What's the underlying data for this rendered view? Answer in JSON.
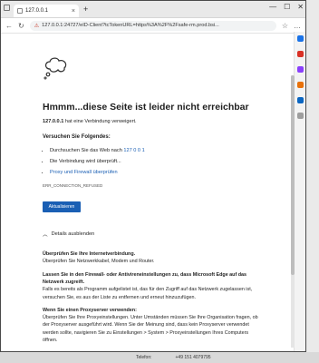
{
  "browser": {
    "tab_title": "127.0.0.1",
    "tab_close": "×",
    "new_tab": "+",
    "minimize": "—",
    "maximize": "☐",
    "close": "✕",
    "url_warning": "⚠",
    "url": "127.0.0.1:24727/eID-Client?tcTokenURL=https%3A%2F%2Fsafe-rm.prod.bsi..."
  },
  "page": {
    "heading": "Hmmm...diese Seite ist leider nicht erreichbar",
    "host": "127.0.0.1",
    "refused_text": " hat eine Verbindung verweigert.",
    "try_heading": "Versuchen Sie Folgendes:",
    "try_items": [
      {
        "prefix": "Durchsuchen Sie das Web nach ",
        "link": "127 0 0 1"
      },
      {
        "prefix": "Die Verbindung wird überprüft...",
        "link": ""
      },
      {
        "prefix": "",
        "link": "Proxy und Firewall überprüfen"
      }
    ],
    "error_code": "ERR_CONNECTION_REFUSED",
    "refresh_button": "Aktualisieren",
    "details_toggle": "Details ausblenden",
    "sections": [
      {
        "title": "Überprüfen Sie Ihre Internetverbindung.",
        "body": "Überprüfen Sie Netzwerkkabel, Modem und Router."
      },
      {
        "title": "Lassen Sie in den Firewall- oder Antivireneinstellungen zu, dass Microsoft Edge auf das Netzwerk zugreift.",
        "body": "Falls es bereits als Programm aufgelistet ist, das für den Zugriff auf das Netzwerk zugelassen ist, versuchen Sie, es aus der Liste zu entfernen und erneut hinzuzufügen."
      },
      {
        "title": "Wenn Sie einen Proxyserver verwenden:",
        "body": "Überprüfen Sie Ihre Proxyeinstellungen. Unter Umständen müssen Sie Ihre Organisation fragen, ob der Proxyserver ausgeführt wird. Wenn Sie der Meinung sind, dass kein Proxyserver verwendet werden sollte, navigieren Sie zu Einstellungen > System > Proxyeinstellungen Ihres Computers öffnen."
      }
    ]
  },
  "background": {
    "left": "Telefon:",
    "right": "+49 151 4079795"
  },
  "colors": {
    "link": "#1a5fb4",
    "button": "#1a5fb4",
    "url_warning": "#c42b1c"
  }
}
